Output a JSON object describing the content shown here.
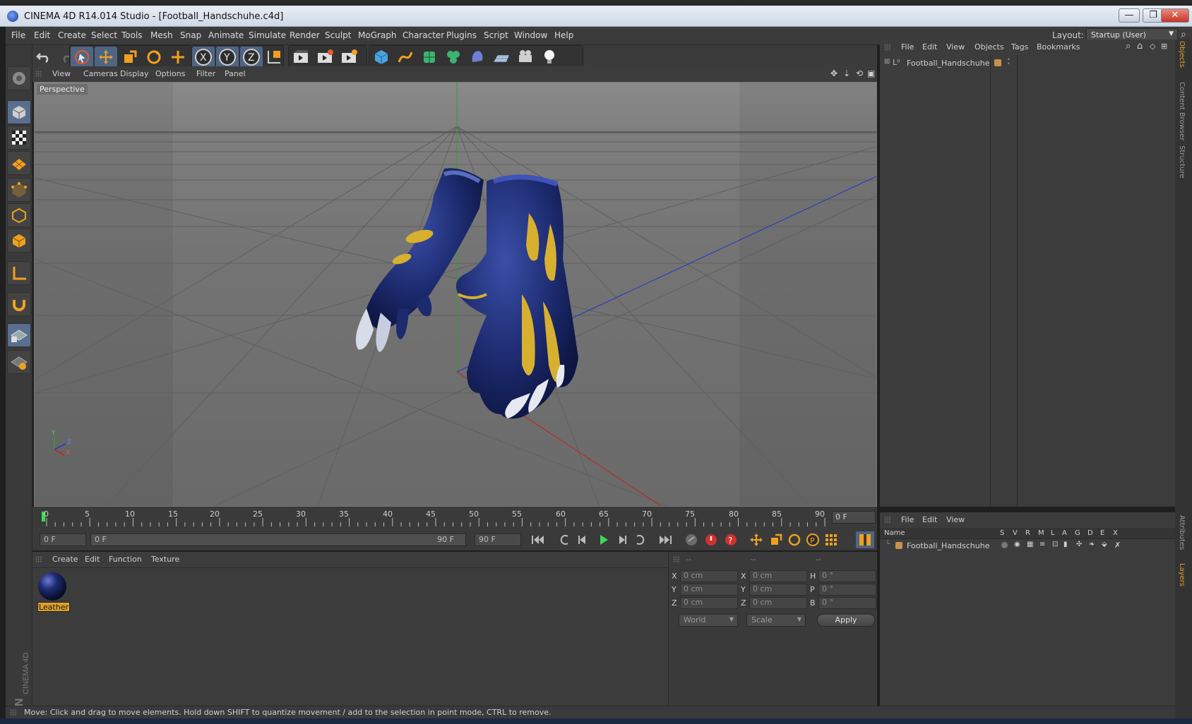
{
  "window": {
    "title": "CINEMA 4D R14.014 Studio - [Football_Handschuhe.c4d]",
    "buttons": [
      "—",
      "❐",
      "✕"
    ]
  },
  "menubar": {
    "items": [
      "File",
      "Edit",
      "Create",
      "Select",
      "Tools",
      "Mesh",
      "Snap",
      "Animate",
      "Simulate",
      "Render",
      "Sculpt",
      "MoGraph",
      "Character",
      "Plugins",
      "Script",
      "Window",
      "Help"
    ],
    "layout_label": "Layout:",
    "layout_value": "Startup (User)"
  },
  "viewport": {
    "menu": [
      "View",
      "Cameras",
      "Display",
      "Options",
      "Filter",
      "Panel"
    ],
    "label": "Perspective",
    "axis_labels": [
      "Y",
      "Z",
      "X"
    ]
  },
  "timeline": {
    "ticks": [
      "0",
      "5",
      "10",
      "15",
      "20",
      "25",
      "30",
      "35",
      "40",
      "45",
      "50",
      "55",
      "60",
      "65",
      "70",
      "75",
      "80",
      "85",
      "90"
    ],
    "current_frame": "0 F",
    "start_field": "0 F",
    "range_start": "0 F",
    "range_end": "90 F",
    "end_field": "90 F"
  },
  "material_manager": {
    "menu": [
      "Create",
      "Edit",
      "Function",
      "Texture"
    ],
    "materials": [
      {
        "name": "Leather",
        "color": "#1c2a6e"
      }
    ]
  },
  "coordinates": {
    "headers": [
      "--",
      "--",
      "--"
    ],
    "rows": [
      {
        "a_label": "X",
        "a_val": "0 cm",
        "b_label": "X",
        "b_val": "0 cm",
        "c_label": "H",
        "c_val": "0 °"
      },
      {
        "a_label": "Y",
        "a_val": "0 cm",
        "b_label": "Y",
        "b_val": "0 cm",
        "c_label": "P",
        "c_val": "0 °"
      },
      {
        "a_label": "Z",
        "a_val": "0 cm",
        "b_label": "Z",
        "b_val": "0 cm",
        "c_label": "B",
        "c_val": "0 °"
      }
    ],
    "mode_dropdown": "World",
    "scale_dropdown": "Scale",
    "apply_label": "Apply"
  },
  "object_manager": {
    "menu": [
      "File",
      "Edit",
      "View",
      "Objects",
      "Tags",
      "Bookmarks"
    ],
    "objects": [
      {
        "name": "Football_Handschuhe",
        "layer_color": "#c8914a"
      }
    ]
  },
  "layer_manager": {
    "menu": [
      "File",
      "Edit",
      "View"
    ],
    "columns": [
      "Name",
      "S",
      "V",
      "R",
      "M",
      "L",
      "A",
      "G",
      "D",
      "E",
      "X"
    ],
    "layers": [
      {
        "name": "Football_Handschuhe"
      }
    ]
  },
  "right_tabs": [
    "Objects",
    "Content Browser",
    "Structure",
    "Attributes",
    "Layers"
  ],
  "status_text": "Move: Click and drag to move elements. Hold down SHIFT to quantize movement / add to the selection in point mode, CTRL to remove.",
  "colors": {
    "accent_orange": "#e0a02a",
    "active_blue": "#4f6585",
    "glove_blue": "#1c2a6e",
    "glove_yellow": "#d8b030"
  }
}
